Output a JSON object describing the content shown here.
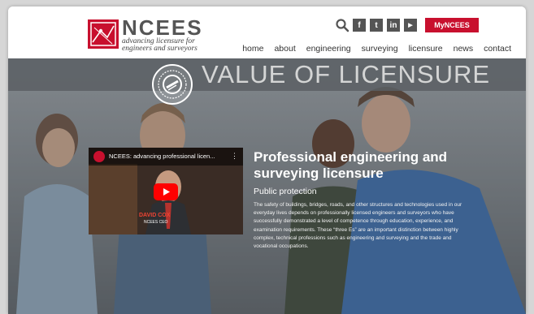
{
  "header": {
    "logo": {
      "name": "NCEES",
      "tagline_line1": "advancing licensure for",
      "tagline_line2": "engineers and surveyors"
    },
    "utility": {
      "social": [
        {
          "icon": "facebook-icon",
          "glyph": "f"
        },
        {
          "icon": "twitter-icon",
          "glyph": "t"
        },
        {
          "icon": "linkedin-icon",
          "glyph": "in"
        },
        {
          "icon": "youtube-icon",
          "glyph": "▶"
        }
      ],
      "my_button": "MyNCEES"
    },
    "nav": [
      "home",
      "about",
      "engineering",
      "surveying",
      "licensure",
      "news",
      "contact"
    ]
  },
  "hero": {
    "banner_title": "VALUE OF LICENSURE",
    "video": {
      "title": "NCEES: advancing professional licen...",
      "lower_third_name": "DAVID COX",
      "lower_third_org": "NCEES CEO"
    },
    "heading": "Professional engineering and surveying licensure",
    "subheading": "Public protection",
    "body": "The safety of buildings, bridges, roads, and other structures and technologies used in our everyday lives depends on professionally licensed engineers and surveyors who have successfully demonstrated a level of competence through education, experience, and examination requirements. These “three Es” are an important distinction between highly complex, technical professions such as engineering and surveying and the trade and vocational occupations."
  },
  "colors": {
    "brand_red": "#c8102e",
    "nav_text": "#333333",
    "banner_overlay": "#5a5f64"
  }
}
